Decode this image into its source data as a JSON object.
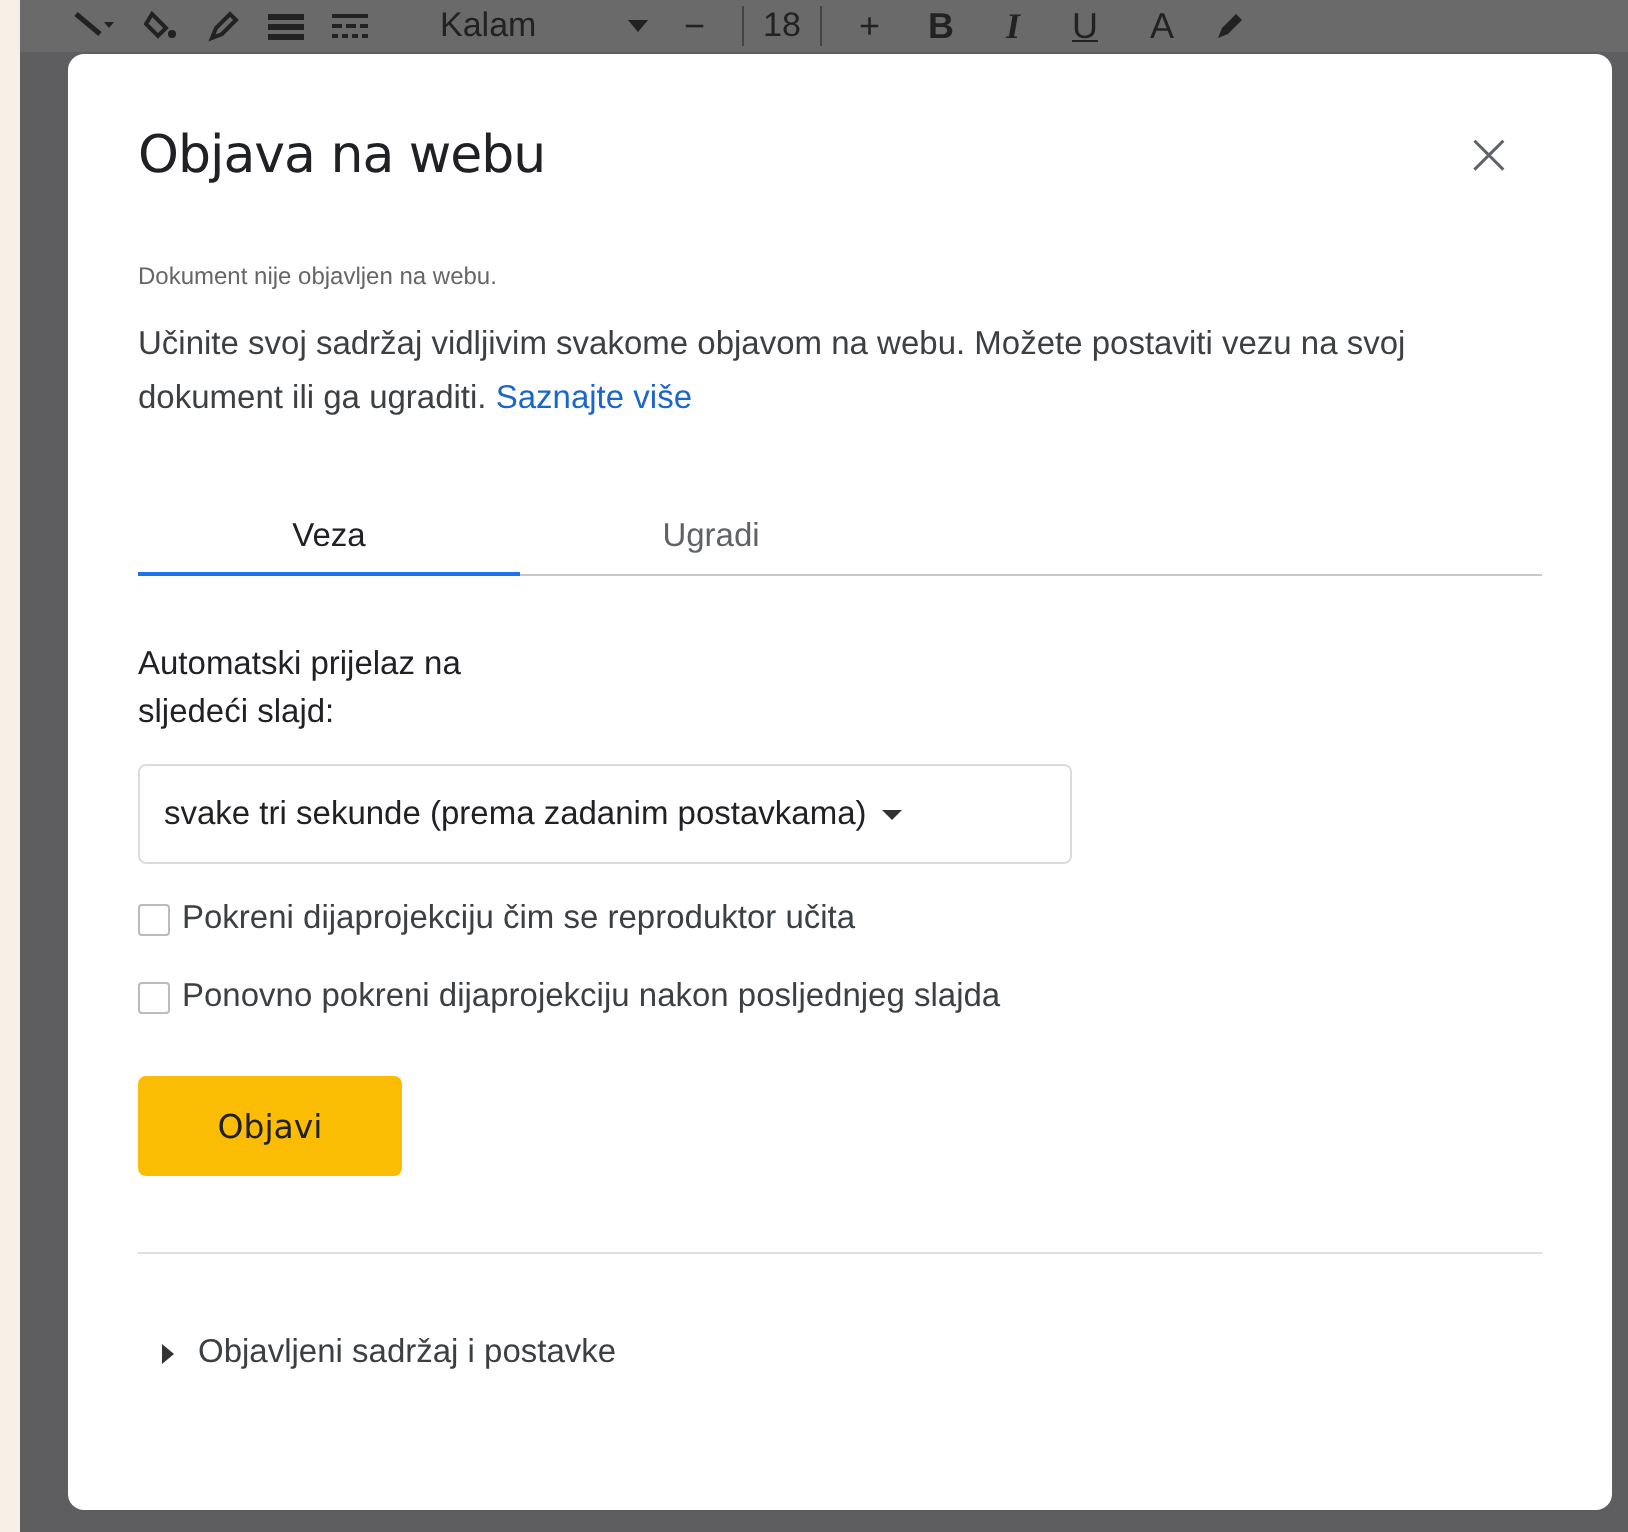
{
  "toolbar": {
    "font": "Kalam",
    "minus": "−",
    "size": "18",
    "plus": "+",
    "format_buttons": [
      "B",
      "I",
      "U",
      "A"
    ]
  },
  "dialog": {
    "title": "Objava na webu",
    "close": "×",
    "status": "Dokument nije objavljen na webu.",
    "description": "Učinite svoj sadržaj vidljivim svakome objavom na webu. Možete postaviti vezu na svoj dokument ili ga ugraditi.",
    "link": "Saznajte više",
    "tabs": [
      {
        "label": "Veza",
        "selected": true
      },
      {
        "label": "Ugradi",
        "selected": false
      }
    ],
    "advance_label": "Automatski prijelaz na sljedeći slajd:",
    "advance_value": "svake tri sekunde (prema zadanim postavkama)",
    "options": [
      {
        "label": "Pokreni dijaprojekciju čim se reproduktor učita",
        "checked": false
      },
      {
        "label": "Ponovno pokreni dijaprojekciju nakon posljednjeg slajda",
        "checked": false
      }
    ],
    "publish_button": "Objavi",
    "section": {
      "label": "Objavljeni sadržaj i postavke",
      "expanded": false
    }
  }
}
